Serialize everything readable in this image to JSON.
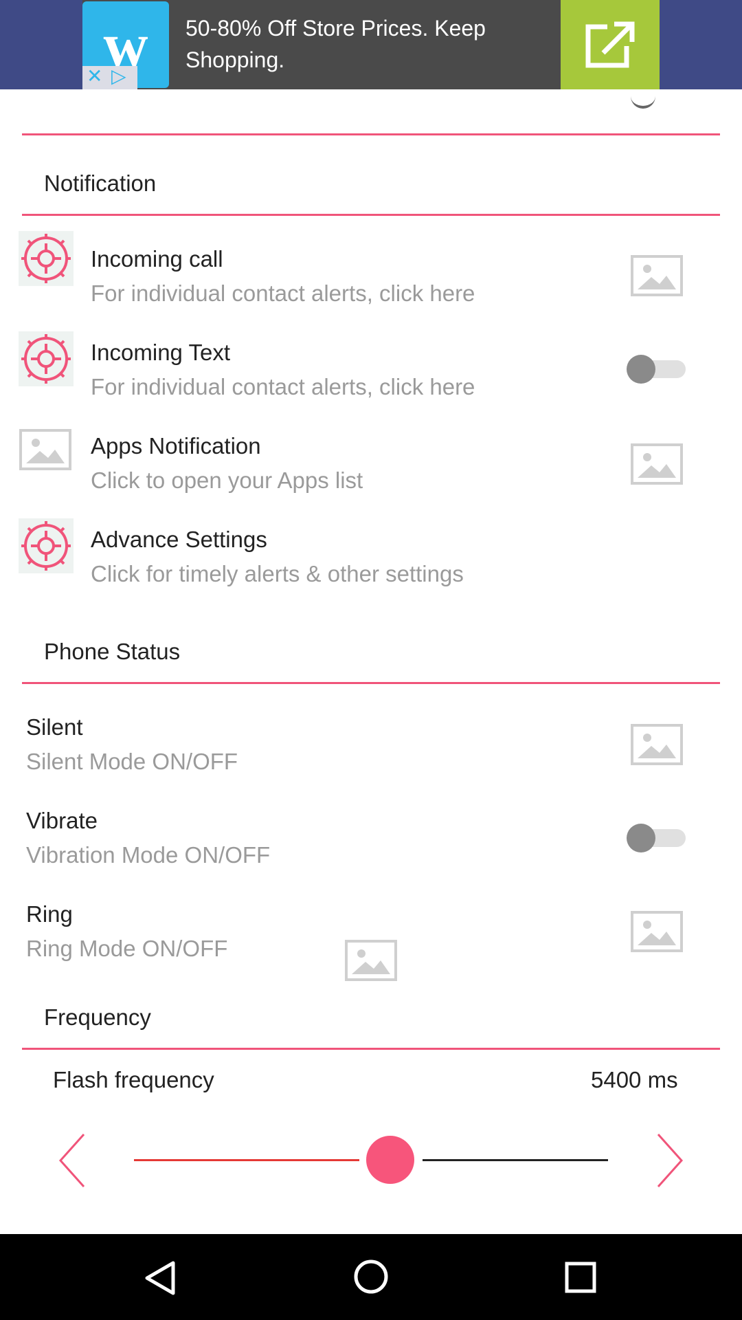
{
  "ad": {
    "logo_letter": "w",
    "text": "50-80% Off Store Prices. Keep Shopping.",
    "action_icon": "external-link-icon",
    "close_icon": "close-icon",
    "adchoices_icon": "adchoices-icon"
  },
  "sections": {
    "notification": "Notification",
    "phone_status": "Phone Status",
    "frequency": "Frequency"
  },
  "notification_items": [
    {
      "title": "Incoming call",
      "subtitle": "For individual contact alerts, click here"
    },
    {
      "title": "Incoming Text",
      "subtitle": "For individual contact alerts, click here",
      "toggle": "off"
    },
    {
      "title": "Apps Notification",
      "subtitle": "Click to open your Apps list"
    },
    {
      "title": "Advance Settings",
      "subtitle": "Click for timely alerts & other settings"
    }
  ],
  "phone_status_items": [
    {
      "title": "Silent",
      "subtitle": "Silent Mode ON/OFF"
    },
    {
      "title": "Vibrate",
      "subtitle": "Vibration Mode ON/OFF",
      "toggle": "off"
    },
    {
      "title": "Ring",
      "subtitle": "Ring Mode ON/OFF"
    }
  ],
  "flash": {
    "label": "Flash frequency",
    "value": "5400 ms",
    "slider_fraction": 0.54
  },
  "colors": {
    "accent": "#f0547a",
    "thumb": "#f7557b",
    "ad_green": "#a6c83b",
    "ad_blue": "#2fb6ea"
  }
}
